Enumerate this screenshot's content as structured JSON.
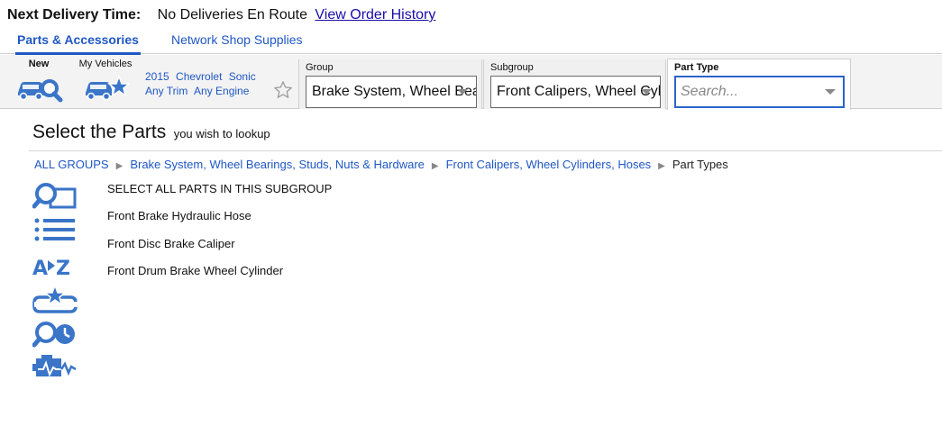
{
  "delivery": {
    "label": "Next Delivery Time:",
    "value": "No Deliveries En Route",
    "history_link": "View Order History"
  },
  "tabs": [
    {
      "label": "Parts & Accessories",
      "active": true
    },
    {
      "label": "Network Shop Supplies",
      "active": false
    }
  ],
  "toolbar": {
    "new_label": "New",
    "my_vehicles_label": "My Vehicles",
    "vehicle": {
      "year": "2015",
      "make": "Chevrolet",
      "model": "Sonic",
      "trim": "Any Trim",
      "engine": "Any Engine"
    },
    "favorite_icon": "star-outline-icon"
  },
  "filters": {
    "group": {
      "label": "Group",
      "value": "Brake System, Wheel Bearings, Studs, Nuts & Hardware"
    },
    "subgroup": {
      "label": "Subgroup",
      "value": "Front Calipers, Wheel Cylinders, Hoses"
    },
    "part_type": {
      "label": "Part Type",
      "placeholder": "Search..."
    }
  },
  "main": {
    "title": "Select the Parts",
    "subtitle": "you wish to lookup",
    "breadcrumbs": [
      "ALL GROUPS",
      "Brake System, Wheel Bearings, Studs, Nuts & Hardware",
      "Front Calipers, Wheel Cylinders, Hoses"
    ],
    "current_crumb": "Part Types",
    "parts": [
      "SELECT ALL PARTS IN THIS SUBGROUP",
      "Front Brake Hydraulic Hose",
      "Front Disc Brake Caliper",
      "Front Drum Brake Wheel Cylinder"
    ],
    "side_icons": [
      "search-parts-icon",
      "list-view-icon",
      "a-to-z-sort-icon",
      "favorite-tools-icon",
      "search-history-icon",
      "diagnostics-icon"
    ]
  },
  "colors": {
    "accent": "#1f57c3",
    "icon_blue": "#3a75c8",
    "link": "#1a0dab",
    "toolbar_bg": "#f3f3f3"
  }
}
